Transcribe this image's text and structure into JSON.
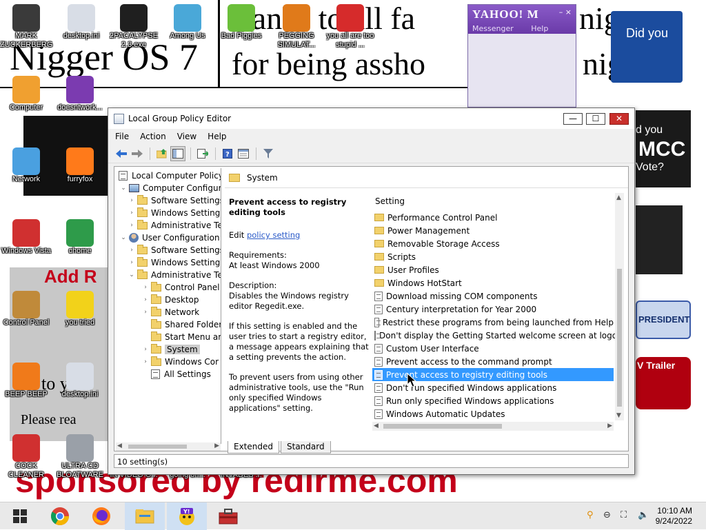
{
  "desktop": {
    "wallpaper_lines": [
      "Nigger OS 7",
      "thanks to all fa",
      "for being assho",
      "nigga",
      "nigg",
      "Add R",
      "to your",
      "Please rea",
      "sponsored by redirme.com",
      "PRESIDENT",
      "Did you",
      "d you",
      "Vote?",
      "MCC",
      "V Trailer"
    ],
    "icons": [
      {
        "label": "MARK ZUCKERBERG",
        "color": "#3a3a3a"
      },
      {
        "label": "desktop.ini",
        "color": "#d8dde6"
      },
      {
        "label": "2PACALYPSE 2.3.exe",
        "color": "#1f1f1f"
      },
      {
        "label": "Among Us",
        "color": "#4aa8d8"
      },
      {
        "label": "Bad Piggies",
        "color": "#6bbf3a"
      },
      {
        "label": "PEGGING SIMULAT...",
        "color": "#e07a1a"
      },
      {
        "label": "you all are too stupid ...",
        "color": "#d62b2b"
      },
      {
        "label": "Computer",
        "color": "#f0a030"
      },
      {
        "label": "doesntwork...",
        "color": "#7b3bb0"
      },
      {
        "label": "Network",
        "color": "#4aa0e0"
      },
      {
        "label": "furryfox",
        "color": "#ff7a1a"
      },
      {
        "label": "Windows Vista",
        "color": "#d03030"
      },
      {
        "label": "chome",
        "color": "#2e9b4a"
      },
      {
        "label": "Control Panel",
        "color": "#c08a3a"
      },
      {
        "label": "you tried",
        "color": "#f2d21a"
      },
      {
        "label": "BEEP BEEP",
        "color": "#f07a1a"
      },
      {
        "label": "desktop.ini",
        "color": "#d8dde6"
      },
      {
        "label": "COCK CLEANER",
        "color": "#d03030"
      },
      {
        "label": "ULTRA CD BLOATWARE",
        "color": "#9aa0a8"
      },
      {
        "label": "ANGEL BIRDS IN VIDEO G...",
        "color": "#d03030"
      },
      {
        "label": "what the fuck is going on...",
        "color": "#777"
      },
      {
        "label": "RUSSIA INVADES ...",
        "color": "#4a6ad0"
      },
      {
        "label": "AMM",
        "color": "#777"
      }
    ]
  },
  "yahoo": {
    "logo": "YAHOO! M",
    "menu": [
      "Messenger",
      "Help"
    ],
    "controls": "– ×"
  },
  "window": {
    "title": "Local Group Policy Editor",
    "controls": {
      "minimize": "—",
      "maximize": "☐",
      "close": "✕"
    },
    "menu": [
      "File",
      "Action",
      "View",
      "Help"
    ]
  },
  "tree": {
    "root": "Local Computer Policy",
    "nodes": [
      {
        "label": "Computer Configura",
        "level": 1,
        "arrow": "⌄",
        "icon": "pc"
      },
      {
        "label": "Software Settings",
        "level": 2,
        "arrow": "›",
        "icon": "folder"
      },
      {
        "label": "Windows Setting",
        "level": 2,
        "arrow": "›",
        "icon": "folder"
      },
      {
        "label": "Administrative Te",
        "level": 2,
        "arrow": "›",
        "icon": "folder"
      },
      {
        "label": "User Configuration",
        "level": 1,
        "arrow": "⌄",
        "icon": "user"
      },
      {
        "label": "Software Settings",
        "level": 2,
        "arrow": "›",
        "icon": "folder"
      },
      {
        "label": "Windows Setting",
        "level": 2,
        "arrow": "›",
        "icon": "folder"
      },
      {
        "label": "Administrative Te",
        "level": 2,
        "arrow": "⌄",
        "icon": "folder"
      },
      {
        "label": "Control Panel",
        "level": 3,
        "arrow": "›",
        "icon": "folder"
      },
      {
        "label": "Desktop",
        "level": 3,
        "arrow": "›",
        "icon": "folder"
      },
      {
        "label": "Network",
        "level": 3,
        "arrow": "›",
        "icon": "folder"
      },
      {
        "label": "Shared Folder",
        "level": 3,
        "arrow": "",
        "icon": "folder"
      },
      {
        "label": "Start Menu ar",
        "level": 3,
        "arrow": "",
        "icon": "folder"
      },
      {
        "label": "System",
        "level": 3,
        "arrow": "›",
        "icon": "folder",
        "selected": true
      },
      {
        "label": "Windows Cor",
        "level": 3,
        "arrow": "›",
        "icon": "folder"
      },
      {
        "label": "All Settings",
        "level": 3,
        "arrow": "",
        "icon": "settings"
      }
    ]
  },
  "section": {
    "title": "System"
  },
  "description": {
    "heading": "Prevent access to registry editing tools",
    "edit_prefix": "Edit",
    "edit_link": "policy setting",
    "requirements_label": "Requirements:",
    "requirements_value": "At least Windows 2000",
    "description_label": "Description:",
    "description_value": "Disables the Windows registry editor Regedit.exe.",
    "para1": "If this setting is enabled and the user tries to start a registry editor, a message appears explaining that a setting prevents the action.",
    "para2": "To prevent users from using other administrative tools, use the \"Run only specified Windows applications\" setting."
  },
  "list": {
    "column_header": "Setting",
    "rows": [
      {
        "label": "Performance Control Panel",
        "type": "folder"
      },
      {
        "label": "Power Management",
        "type": "folder"
      },
      {
        "label": "Removable Storage Access",
        "type": "folder"
      },
      {
        "label": "Scripts",
        "type": "folder"
      },
      {
        "label": "User Profiles",
        "type": "folder"
      },
      {
        "label": "Windows HotStart",
        "type": "folder"
      },
      {
        "label": "Download missing COM components",
        "type": "policy"
      },
      {
        "label": "Century interpretation for Year 2000",
        "type": "policy"
      },
      {
        "label": "Restrict these programs from being launched from Help",
        "type": "policy"
      },
      {
        "label": "Don't display the Getting Started welcome screen at logon",
        "type": "policy"
      },
      {
        "label": "Custom User Interface",
        "type": "policy"
      },
      {
        "label": "Prevent access to the command prompt",
        "type": "policy"
      },
      {
        "label": "Prevent access to registry editing tools",
        "type": "policy",
        "selected": true
      },
      {
        "label": "Don't run specified Windows applications",
        "type": "policy"
      },
      {
        "label": "Run only specified Windows applications",
        "type": "policy"
      },
      {
        "label": "Windows Automatic Updates",
        "type": "policy"
      }
    ]
  },
  "tabs": [
    "Extended",
    "Standard"
  ],
  "status": "10 setting(s)",
  "taskbar": {
    "apps": [
      "start-icon",
      "chrome-icon",
      "firefox-icon",
      "explorer-icon",
      "yahoo-icon",
      "toolbox-icon"
    ],
    "time": "10:10 AM",
    "date": "9/24/2022"
  }
}
